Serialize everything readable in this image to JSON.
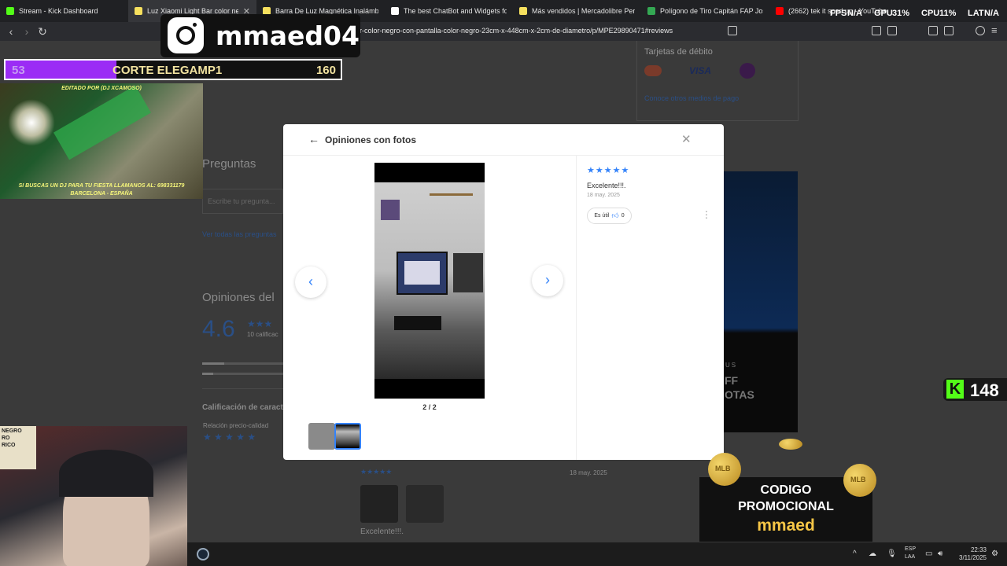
{
  "browser": {
    "tabs": [
      {
        "title": "Stream - Kick Dashboard",
        "color": "#53fc18",
        "active": false
      },
      {
        "title": "Luz Xiaomi Light Bar color negro",
        "color": "#f6e05e",
        "active": true
      },
      {
        "title": "Barra De Luz Magnética Inalámbrica",
        "color": "#f6e05e",
        "active": false
      },
      {
        "title": "The best ChatBot and Widgets for K",
        "color": "#ffffff",
        "active": false
      },
      {
        "title": "Más vendidos | Mercadolibre Peru",
        "color": "#f6e05e",
        "active": false
      },
      {
        "title": "Polígono de Tiro Capitán FAP José A",
        "color": "#34a853",
        "active": false
      },
      {
        "title": "(2662) tek it sped up - YouTube",
        "color": "#ff0000",
        "active": false
      }
    ],
    "url": "ar-color-negro-con-pantalla-color-negro-23cm-x-448cm-x-2cm-de-diametro/p/MPE29890471#reviews"
  },
  "page": {
    "debit_label": "Tarjetas de débito",
    "card_visa": "VISA",
    "payment_link": "Conoce otros medios de pago",
    "questions_heading": "Preguntas",
    "questions_placeholder": "Escribe tu pregunta...",
    "questions_link": "Ver todas las preguntas",
    "opinions_heading": "Opiniones del",
    "rating_value": "4.6",
    "rating_count": "10 calificac",
    "characteristics_heading": "Calificación de caract",
    "price_quality_label": "Relación precio-calidad",
    "review_date_bg": "18 may. 2025",
    "review_text_bg": "Excelente!!!.",
    "ad_text_1": "US",
    "ad_text_2": "FF",
    "ad_text_3": "OTAS"
  },
  "modal": {
    "title": "Opiniones con fotos",
    "counter": "2 / 2",
    "review": {
      "stars": 5,
      "title": "Excelente!!!.",
      "date": "18 may. 2025",
      "useful_label": "Es útil",
      "useful_count": "0"
    }
  },
  "overlay": {
    "instagram_handle": "mmaed04",
    "progress": {
      "left": "53",
      "label": "CORTE ELEGAMP1",
      "right": "160",
      "fraction": 0.33
    },
    "video_top": "EDITADO POR (DJ XCAMOSO)",
    "video_bottom_1": "SI BUSCAS UN DJ PARA TU FIESTA LLAMANOS AL: 698331179",
    "video_bottom_2": "BARCELONA - ESPAÑA",
    "hud": {
      "fps_label": "FPS",
      "fps_value": "N/A",
      "gpu_label": "GPU",
      "gpu_value": "31%",
      "cpu_label": "CPU",
      "cpu_value": "11%",
      "lat_label": "LAT",
      "lat_value": "N/A"
    },
    "kick_count": "148",
    "promo_line1": "CODIGO",
    "promo_line2": "PROMOCIONAL",
    "promo_line3": "mmaed",
    "coin_label": "MLB",
    "webcam_sign": "NEGRO\nRO\nRICO"
  },
  "taskbar": {
    "lang1": "ESP",
    "lang2": "LAA",
    "time": "22:33",
    "date": "3/11/2025"
  },
  "colors": {
    "accent_blue": "#3483fa",
    "kick_green": "#53fc18",
    "progress_purple": "#9b2cf5",
    "promo_gold": "#f6c646"
  }
}
